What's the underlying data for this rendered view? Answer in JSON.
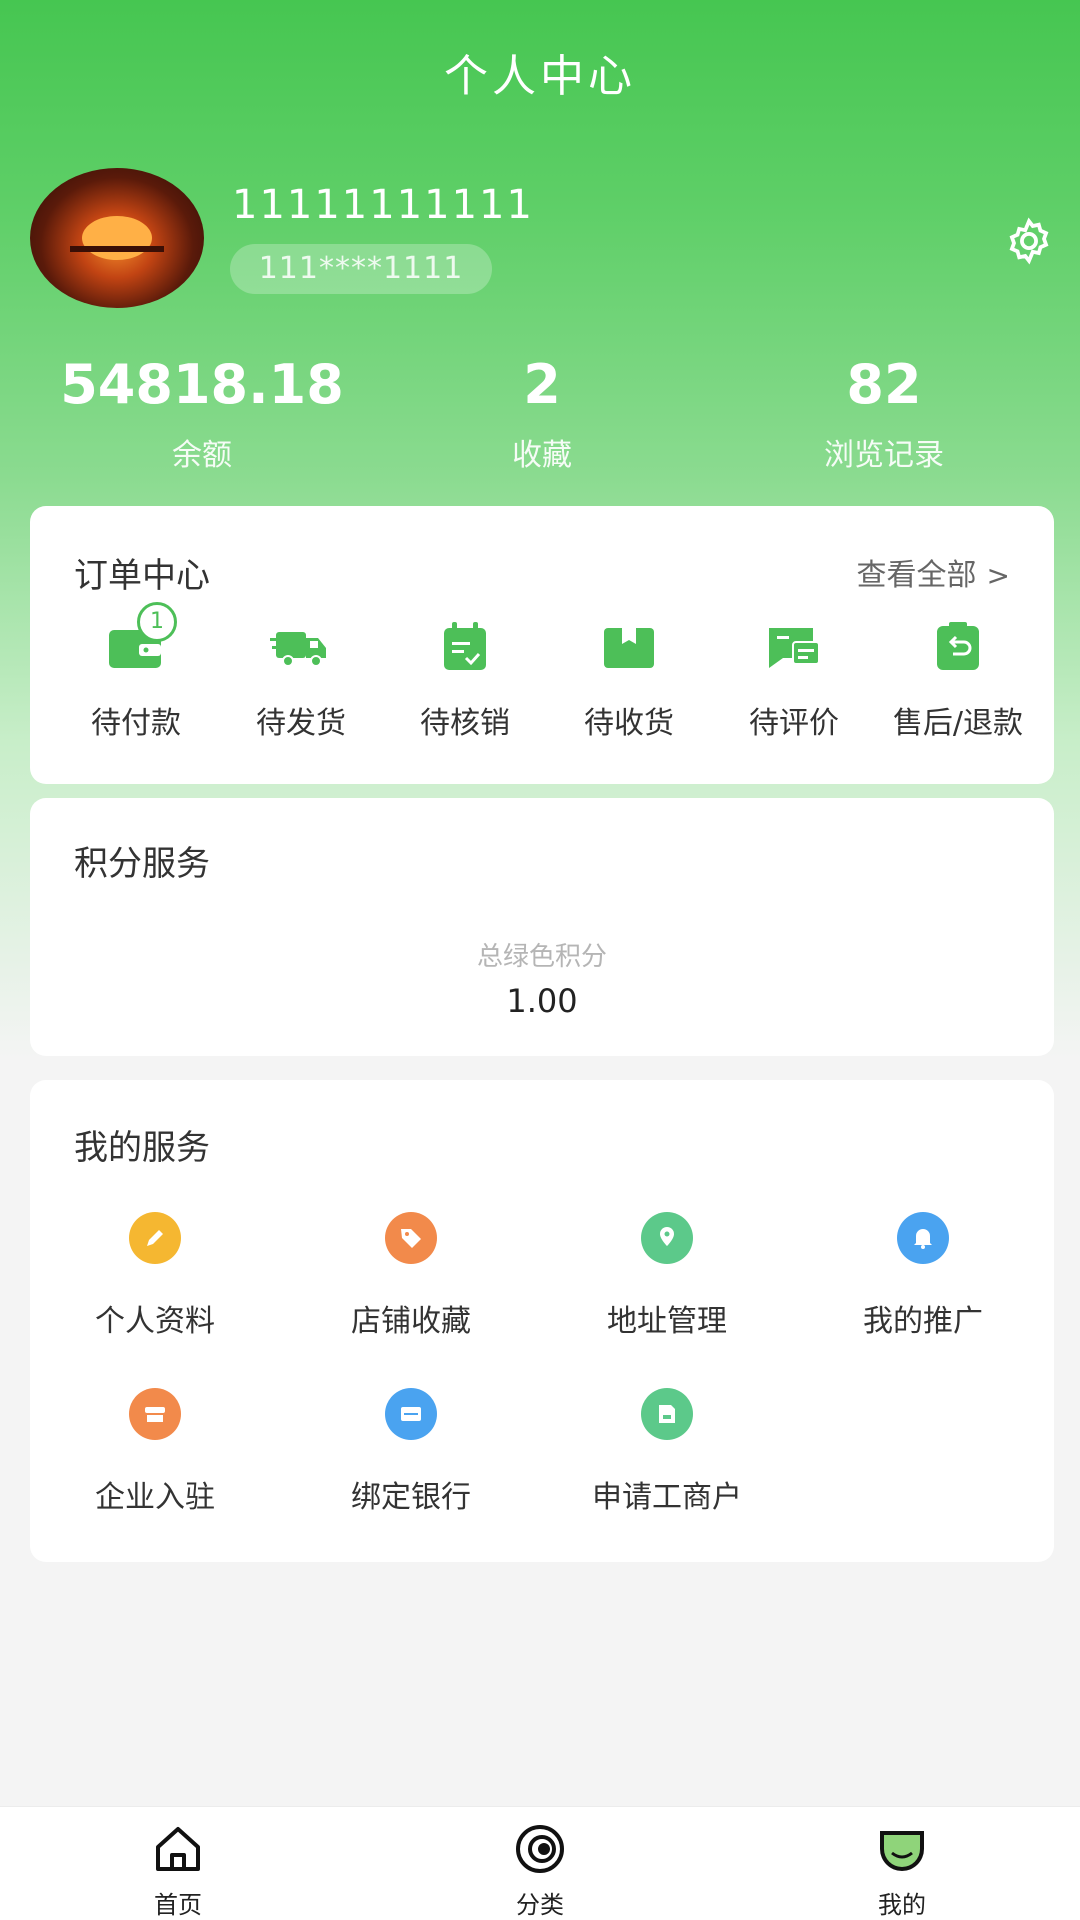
{
  "header": {
    "title": "个人中心"
  },
  "profile": {
    "username": "11111111111",
    "phone_masked": "111****1111"
  },
  "stats": [
    {
      "value": "54818.18",
      "label": "余额"
    },
    {
      "value": "2",
      "label": "收藏"
    },
    {
      "value": "82",
      "label": "浏览记录"
    }
  ],
  "orders": {
    "title": "订单中心",
    "view_all": "查看全部",
    "items": [
      {
        "label": "待付款",
        "icon": "wallet-icon",
        "badge": "1"
      },
      {
        "label": "待发货",
        "icon": "truck-icon"
      },
      {
        "label": "待核销",
        "icon": "calendar-check-icon"
      },
      {
        "label": "待收货",
        "icon": "package-icon"
      },
      {
        "label": "待评价",
        "icon": "comment-icon"
      },
      {
        "label": "售后/退款",
        "icon": "refund-icon"
      }
    ]
  },
  "points": {
    "title": "积分服务",
    "label": "总绿色积分",
    "value": "1.00"
  },
  "services": {
    "title": "我的服务",
    "items": [
      {
        "label": "个人资料",
        "icon": "pencil-icon",
        "color": "#f5b731"
      },
      {
        "label": "店铺收藏",
        "icon": "tag-icon",
        "color": "#f28a4b"
      },
      {
        "label": "地址管理",
        "icon": "location-icon",
        "color": "#5cc98a"
      },
      {
        "label": "我的推广",
        "icon": "bell-icon",
        "color": "#4aa3f0"
      },
      {
        "label": "企业入驻",
        "icon": "shop-icon",
        "color": "#f28a4b"
      },
      {
        "label": "绑定银行",
        "icon": "card-icon",
        "color": "#4aa3f0"
      },
      {
        "label": "申请工商户",
        "icon": "document-icon",
        "color": "#5cc98a"
      }
    ]
  },
  "tabbar": [
    {
      "label": "首页",
      "icon": "home-icon"
    },
    {
      "label": "分类",
      "icon": "category-icon"
    },
    {
      "label": "我的",
      "icon": "mine-icon"
    }
  ],
  "colors": {
    "brand": "#46c651",
    "icon_green": "#4dbf58"
  }
}
